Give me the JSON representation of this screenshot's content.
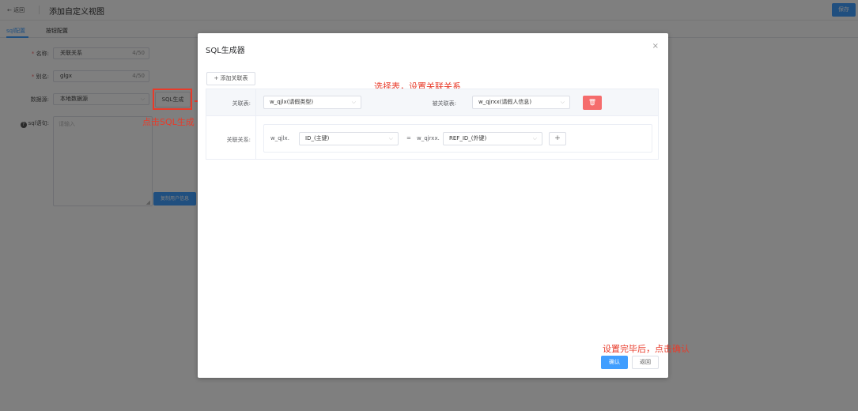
{
  "header": {
    "back_label": "← 返回",
    "title": "添加自定义视图",
    "save_label": "保存"
  },
  "tabs": [
    {
      "label": "sql配置"
    },
    {
      "label": "按钮配置"
    }
  ],
  "form": {
    "name_label": "名称:",
    "name_value": "关联关系",
    "name_count": "4/50",
    "alias_label": "别名:",
    "alias_value": "glgx",
    "alias_count": "4/50",
    "datasource_label": "数据源:",
    "datasource_value": "本地数据源",
    "sql_gen_label": "SQL生成",
    "sql_label": "sql语句:",
    "sql_placeholder": "请输入",
    "copy_label": "复制用户信息"
  },
  "annotations": {
    "click_sql_gen": "点击SQL生成",
    "select_table": "选择表，设置关联关系",
    "confirm_hint": "设置完毕后，点击确认"
  },
  "dialog": {
    "title": "SQL生成器",
    "close_glyph": "×",
    "add_table_label": "+ 添加关联表",
    "join_table_label": "关联表:",
    "join_table_value": "w_qjlx(请假类型)",
    "joined_table_label": "被关联表:",
    "joined_table_value": "w_qjrxx(请假人信息)",
    "delete_glyph": "🗑",
    "relation_label": "关联关系:",
    "left_prefix": "w_qjlx.",
    "left_field": "ID_(主键)",
    "equals": "=",
    "right_prefix": "w_qjrxx.",
    "right_field": "REF_ID_(外键)",
    "plus_glyph": "+",
    "confirm_label": "确认",
    "return_label": "返回"
  },
  "colors": {
    "primary": "#409eff",
    "danger": "#f56c6c",
    "annotation": "#e83b2a"
  }
}
